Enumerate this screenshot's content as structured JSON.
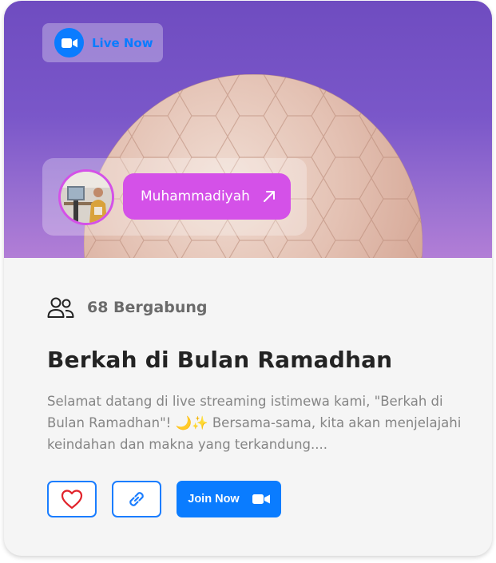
{
  "live_badge": {
    "label": "Live Now",
    "icon": "video-camera-icon"
  },
  "host": {
    "channel_name": "Muhammadiyah",
    "avatar": "host-avatar",
    "link_icon": "arrow-up-right-icon"
  },
  "stream": {
    "participants": "68 Bergabung",
    "participants_icon": "users-icon",
    "title": "Berkah di Bulan Ramadhan",
    "description": "Selamat datang di live streaming istimewa kami, \"Berkah di Bulan Ramadhan\"! 🌙✨ Bersama-sama, kita akan menjelajahi keindahan dan makna yang terkandung...."
  },
  "actions": {
    "like_icon": "heart-icon",
    "share_icon": "link-icon",
    "join_label": "Join Now",
    "join_icon": "video-camera-icon"
  },
  "colors": {
    "primary": "#0a7cff",
    "accent": "#d451e8",
    "heart": "#e1232b",
    "title": "#232323",
    "muted": "#858585"
  }
}
